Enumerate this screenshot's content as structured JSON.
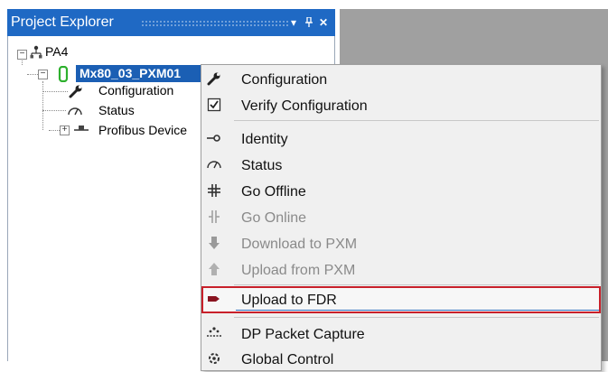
{
  "explorer": {
    "title": "Project Explorer",
    "buttons": {
      "dropdown": "▾",
      "pin": "ꟸ",
      "close": "✕"
    }
  },
  "tree": {
    "root": "PA4",
    "device": "Mx80_03_PXM01",
    "children": [
      "Configuration",
      "Status",
      "Profibus Device"
    ]
  },
  "context_menu": {
    "items": [
      {
        "label": "Configuration",
        "icon": "wrench-icon",
        "enabled": true
      },
      {
        "label": "Verify Configuration",
        "icon": "checkbox-icon",
        "enabled": true
      },
      {
        "label": "Identity",
        "icon": "identity-icon",
        "enabled": true
      },
      {
        "label": "Status",
        "icon": "status-gauge-icon",
        "enabled": true
      },
      {
        "label": "Go Offline",
        "icon": "go-offline-icon",
        "enabled": true
      },
      {
        "label": "Go Online",
        "icon": "go-online-icon",
        "enabled": false
      },
      {
        "label": "Download to PXM",
        "icon": "download-arrow-icon",
        "enabled": false
      },
      {
        "label": "Upload from PXM",
        "icon": "upload-arrow-icon",
        "enabled": false
      },
      {
        "label": "Upload to FDR",
        "icon": "fdr-icon",
        "enabled": true,
        "highlighted": true
      },
      {
        "label": "DP Packet Capture",
        "icon": "packet-capture-icon",
        "enabled": true
      },
      {
        "label": "Global Control",
        "icon": "global-control-icon",
        "enabled": true
      }
    ]
  },
  "colors": {
    "title_bar": "#1f69c4",
    "selection": "#1b5fb4",
    "highlight_border": "#c8202a",
    "document_area": "#a0a0a0"
  }
}
